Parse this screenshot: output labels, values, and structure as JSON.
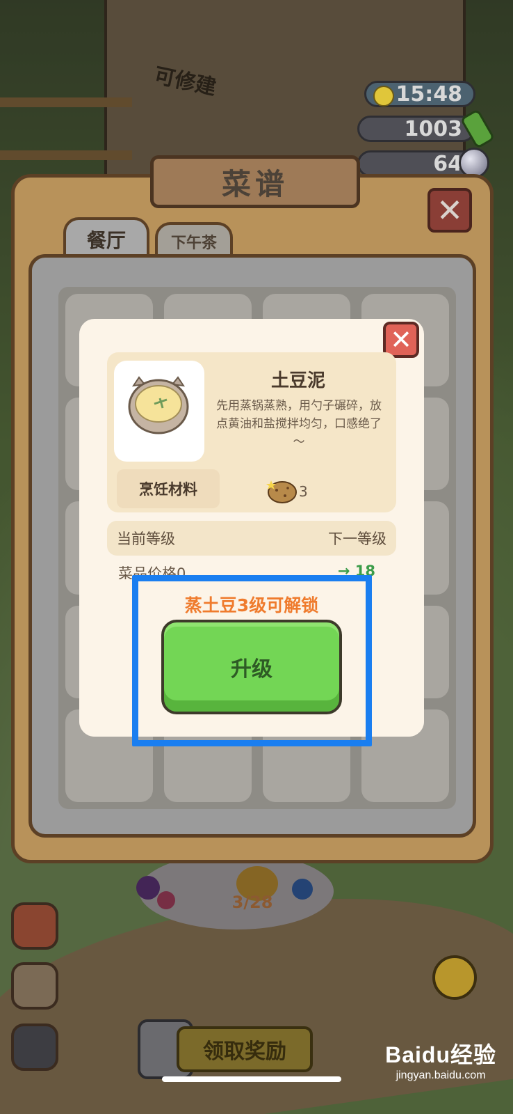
{
  "hud": {
    "time": "15:48",
    "coins": "1003",
    "gems": "64"
  },
  "background": {
    "building_label": "可修建"
  },
  "recipe_book": {
    "title": "菜谱",
    "tabs": [
      {
        "label": "餐厅",
        "active": true
      },
      {
        "label": "下午茶",
        "active": false
      }
    ],
    "pager": "3/28"
  },
  "dialog": {
    "dish_name": "土豆泥",
    "description": "先用蒸锅蒸熟，用勺子碾碎，放点黄油和盐搅拌均匀，口感绝了～",
    "materials_label": "烹饪材料",
    "material_icon": "potato-icon",
    "material_count": "3",
    "current_level_label": "当前等级",
    "next_level_label": "下一等级",
    "price_label": "菜品价格0",
    "next_price": "→ 18",
    "unlock_message": "蒸土豆3级可解锁",
    "upgrade_button": "升级"
  },
  "bottom": {
    "reward_button": "领取奖励"
  },
  "watermark": {
    "logo": "Baidu经验",
    "url": "jingyan.baidu.com"
  },
  "colors": {
    "upgrade_green": "#73d655",
    "unlock_orange": "#ef7b2d",
    "close_red": "#e06358",
    "highlight_blue": "#1a7ef0"
  }
}
